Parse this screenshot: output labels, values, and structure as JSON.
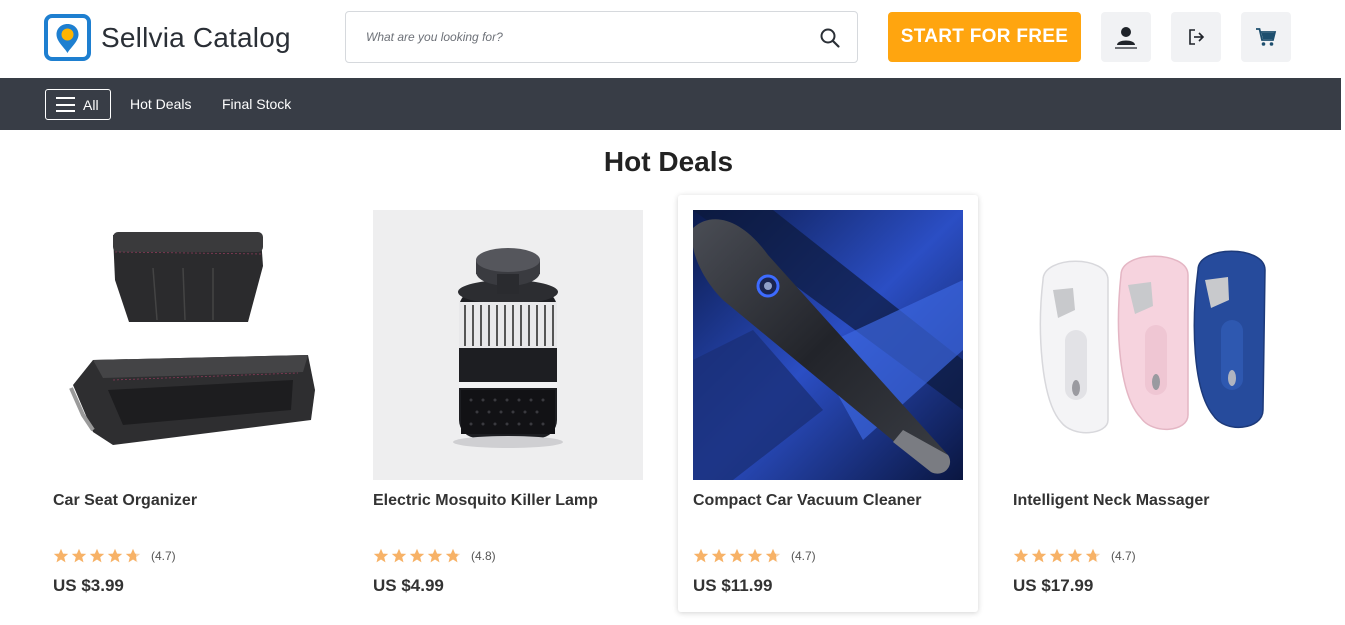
{
  "brand": {
    "name": "Sellvia Catalog",
    "accent": "#1e7fd0",
    "pin": "#ffb400"
  },
  "search": {
    "placeholder": "What are you looking for?",
    "icon": "search-icon"
  },
  "header": {
    "cta_label": "START FOR FREE",
    "cta_color": "#ffa50f",
    "icons": [
      "user-icon",
      "logout-icon",
      "cart-icon"
    ]
  },
  "nav": {
    "all_label": "All",
    "links": [
      "Hot Deals",
      "Final Stock"
    ]
  },
  "page": {
    "title": "Hot Deals"
  },
  "products": [
    {
      "name": "Car Seat Organizer",
      "rating": 4.7,
      "rating_text": "(4.7)",
      "price": "US $3.99"
    },
    {
      "name": "Electric Mosquito Killer Lamp",
      "rating": 4.8,
      "rating_text": "(4.8)",
      "price": "US $4.99"
    },
    {
      "name": "Compact Car Vacuum Cleaner",
      "rating": 4.7,
      "rating_text": "(4.7)",
      "price": "US $11.99"
    },
    {
      "name": "Intelligent Neck Massager",
      "rating": 4.7,
      "rating_text": "(4.7)",
      "price": "US $17.99"
    }
  ],
  "colors": {
    "nav_bg": "#383d46",
    "star": "#f7b267"
  }
}
